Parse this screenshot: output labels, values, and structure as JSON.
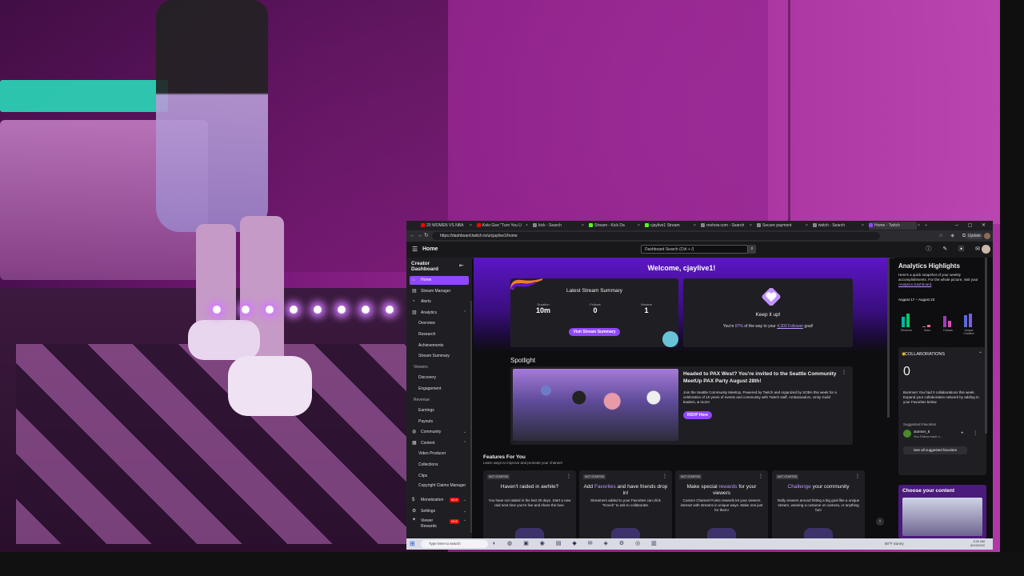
{
  "browser": {
    "tabs": [
      {
        "label": "20 WOMEN VS NBA",
        "color": "#ff0000"
      },
      {
        "label": "Kelo Gee \"Turn You U",
        "color": "#ff0000"
      },
      {
        "label": "kick - Search",
        "color": "#888888"
      },
      {
        "label": "Stream - Kick Da",
        "color": "#53fc18"
      },
      {
        "label": "cjaylive1 Stream",
        "color": "#53fc18"
      },
      {
        "label": "reohow.com - Search",
        "color": "#888888"
      },
      {
        "label": "Secure payment",
        "color": "#888888"
      },
      {
        "label": "twitch - Search",
        "color": "#888888"
      },
      {
        "label": "Home - Twitch",
        "color": "#9147ff"
      }
    ],
    "url": "https://dashboard.twitch.tv/u/cjaylive1/home",
    "update_label": "Update"
  },
  "header": {
    "title": "Home",
    "search_placeholder": "Dashboard Search (Ctrl + /)"
  },
  "sidebar": {
    "title": "Creator Dashboard",
    "items": [
      {
        "label": "Home",
        "kind": "top",
        "icon": "⌂",
        "active": true
      },
      {
        "label": "Stream Manager",
        "kind": "top",
        "icon": "▤"
      },
      {
        "label": "Alerts",
        "kind": "top",
        "icon": "◔"
      },
      {
        "label": "Analytics",
        "kind": "top",
        "icon": "▥",
        "chevron": "⌃"
      },
      {
        "label": "Overview",
        "kind": "sub"
      },
      {
        "label": "Research",
        "kind": "sub"
      },
      {
        "label": "Achievements",
        "kind": "sub"
      },
      {
        "label": "Stream Summary",
        "kind": "sub"
      },
      {
        "label": "Viewers",
        "kind": "head"
      },
      {
        "label": "Discovery",
        "kind": "sub"
      },
      {
        "label": "Engagement",
        "kind": "sub"
      },
      {
        "label": "Revenue",
        "kind": "head"
      },
      {
        "label": "Earnings",
        "kind": "sub"
      },
      {
        "label": "Payouts",
        "kind": "sub"
      },
      {
        "label": "Community",
        "kind": "top",
        "icon": "◍",
        "chevron": "⌄"
      },
      {
        "label": "Content",
        "kind": "top",
        "icon": "▦",
        "chevron": "⌃"
      },
      {
        "label": "Video Producer",
        "kind": "sub"
      },
      {
        "label": "Collections",
        "kind": "sub"
      },
      {
        "label": "Clips",
        "kind": "sub"
      },
      {
        "label": "Copyright Claims Manager",
        "kind": "sub"
      },
      {
        "label": "Monetization",
        "kind": "top",
        "icon": "$",
        "chevron": "⌄",
        "badge": "NEW"
      },
      {
        "label": "Settings",
        "kind": "top",
        "icon": "⚙",
        "chevron": "⌄"
      },
      {
        "label": "Viewer Rewards",
        "kind": "top",
        "icon": "✦",
        "chevron": "⌄",
        "badge": "NEW"
      }
    ]
  },
  "main": {
    "welcome": "Welcome, cjaylive1!",
    "summary": {
      "title": "Latest Stream Summary",
      "duration_label": "Duration",
      "duration_value": "10m",
      "follows_label": "Follows",
      "follows_value": "0",
      "viewers_label": "Viewers",
      "viewers_value": "1",
      "button": "Visit Stream Summary"
    },
    "keep": {
      "title": "Keep it up!",
      "text_pre": "You're ",
      "percent": "87%",
      "text_mid": " of the way to your ",
      "goal": "4,300 Follower",
      "text_post": " goal!"
    },
    "spotlight": {
      "title": "Spotlight",
      "heading": "Headed to PAX West? You're invited to the Seattle Community MeetUp PAX Party August 28th!",
      "body": "Join the Seattle Community MeetUp, Powered by Twitch and organized by SOBA this week for a celebration of 10 years of events and community with Twitch staff, Ambassadors, Unity Guild leaders, & more!",
      "button": "RSVP Here"
    },
    "features": {
      "title": "Features For You",
      "subtitle": "Learn ways to improve and promote your channel",
      "cards": [
        {
          "status": "NOT STARTED",
          "title_pre": "Haven't raided in awhile?",
          "title_accent": "",
          "title_post": "",
          "body": "You have not raided in the last 30 days. Start a new raid next time you're live and share the love."
        },
        {
          "status": "NOT STARTED",
          "title_pre": "Add ",
          "title_accent": "Favorites",
          "title_post": " and have friends drop in!",
          "body": "Streamers added to your Favorites can click \"Knock\" to ask to collaborate."
        },
        {
          "status": "NOT STARTED",
          "title_pre": "Make special ",
          "title_accent": "rewards",
          "title_post": " for your viewers",
          "body": "Custom Channel Points rewards let your viewers interact with streams in unique ways. Make one just for them!"
        },
        {
          "status": "NOT STARTED",
          "title_pre": "",
          "title_accent": "Challenge",
          "title_post": " your community",
          "body": "Rally viewers around hitting a big goal like a unique stream, wearing a costume on camera, or anything fun!"
        }
      ]
    }
  },
  "right": {
    "title": "Analytics Highlights",
    "desc_pre": "Here's a quick snapshot of your weekly accomplishments. For the whole picture, visit your ",
    "desc_link": "Analytics Dashboard",
    "desc_post": ".",
    "date_range": "August 17 – August 23",
    "mini_chart": [
      {
        "label": "Revenue",
        "values": [
          0.45,
          0.6
        ],
        "colors": [
          "#00b5ad",
          "#00c96b"
        ]
      },
      {
        "label": "Subs",
        "values": [
          0.05,
          0.1
        ],
        "colors": [
          "#ff4f6d",
          "#ff6b8a"
        ]
      },
      {
        "label": "Follows",
        "values": [
          0.5,
          0.3
        ],
        "colors": [
          "#a23ab6",
          "#d44fb3"
        ]
      },
      {
        "label": "Unique Chatters",
        "values": [
          0.55,
          0.6
        ],
        "colors": [
          "#5a6bd6",
          "#7b5cf0"
        ]
      }
    ],
    "collab": {
      "title": "COLLABORATIONS",
      "count": "0",
      "text": "Bummer! You had 0 collaborations this week. Expand your collaboration network by adding to your Favorites below.",
      "sugg_title": "Suggested Favorites",
      "sugg_name": "xtormer_8",
      "sugg_sub": "You Follow each o...",
      "see_all": "See all suggested favorites"
    },
    "choose": "Choose your content"
  },
  "taskbar": {
    "search": "Type here to search",
    "weather": "50°F  Sunny",
    "time": "3:32 AM",
    "date": "8/24/2022"
  }
}
